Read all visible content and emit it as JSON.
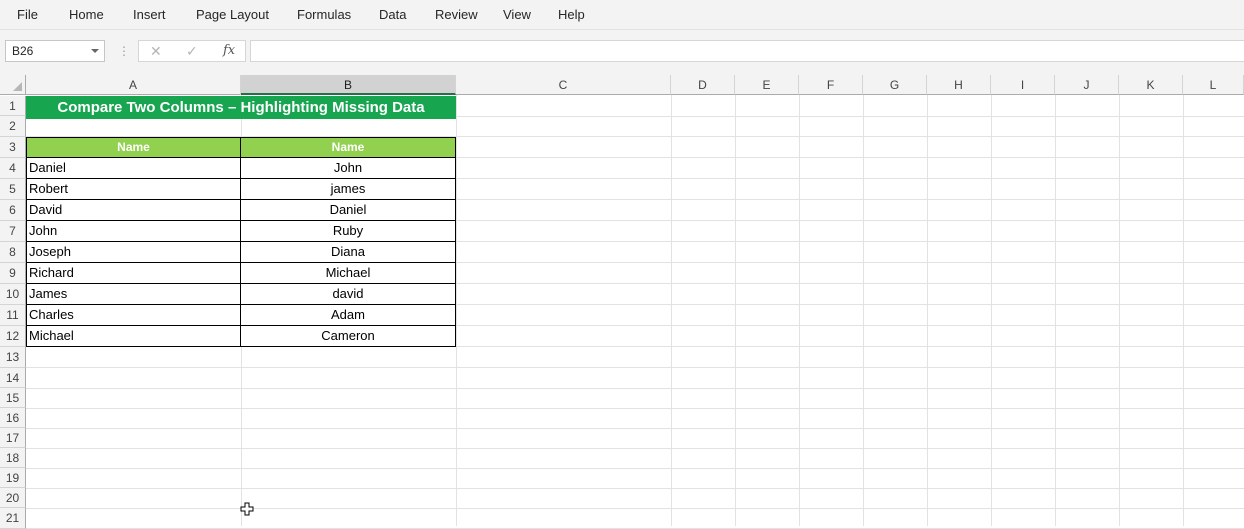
{
  "menu": [
    "File",
    "Home",
    "Insert",
    "Page Layout",
    "Formulas",
    "Data",
    "Review",
    "View",
    "Help"
  ],
  "formula_bar": {
    "name_box": "B26",
    "cancel_icon": "✕",
    "enter_icon": "✓",
    "fx_label": "fx",
    "formula": ""
  },
  "columns": [
    "A",
    "B",
    "C",
    "D",
    "E",
    "F",
    "G",
    "H",
    "I",
    "J",
    "K",
    "L"
  ],
  "rows": [
    "1",
    "2",
    "3",
    "4",
    "5",
    "6",
    "7",
    "8",
    "9",
    "10",
    "11",
    "12",
    "13",
    "14",
    "15",
    "16",
    "17",
    "18",
    "19",
    "20",
    "21"
  ],
  "sheet": {
    "title": "Compare Two Columns – Highlighting Missing Data",
    "header_a": "Name",
    "header_b": "Name",
    "col_a": [
      "Daniel",
      "Robert",
      "David",
      "John",
      "Joseph",
      "Richard",
      "James",
      "Charles",
      "Michael"
    ],
    "col_b": [
      "John",
      "james",
      "Daniel",
      "Ruby",
      "Diana",
      "Michael",
      "david",
      "Adam",
      "Cameron"
    ]
  },
  "colors": {
    "title_bg": "#17a550",
    "header_bg": "#92d050",
    "selected_accent": "#217346"
  }
}
